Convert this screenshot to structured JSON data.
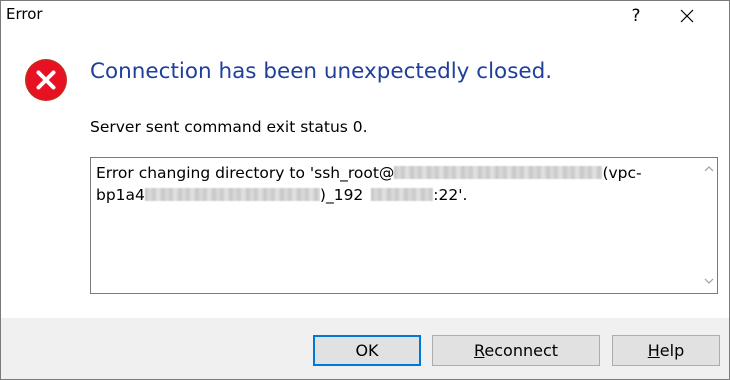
{
  "window": {
    "title": "Error",
    "help_glyph": "?"
  },
  "dialog": {
    "heading": "Connection has been unexpectedly closed.",
    "subtext": "Server sent command exit status 0.",
    "message": {
      "line1_start": "Error changing directory to 'ssh_root@",
      "line1_end": "(vpc-",
      "line2_start": "bp1a4",
      "line2_mid": ")_192",
      "line2_end": ":22'."
    }
  },
  "buttons": {
    "ok": "OK",
    "reconnect_mnemonic": "R",
    "reconnect_rest": "econnect",
    "help_mnemonic": "H",
    "help_rest": "elp"
  },
  "icons": {
    "error": "error-icon",
    "close": "close-icon",
    "scroll_up": "chevron-up-icon",
    "scroll_down": "chevron-down-icon"
  },
  "colors": {
    "heading": "#1f3f9b",
    "error_red": "#e81123",
    "focus_border": "#0078d7"
  }
}
